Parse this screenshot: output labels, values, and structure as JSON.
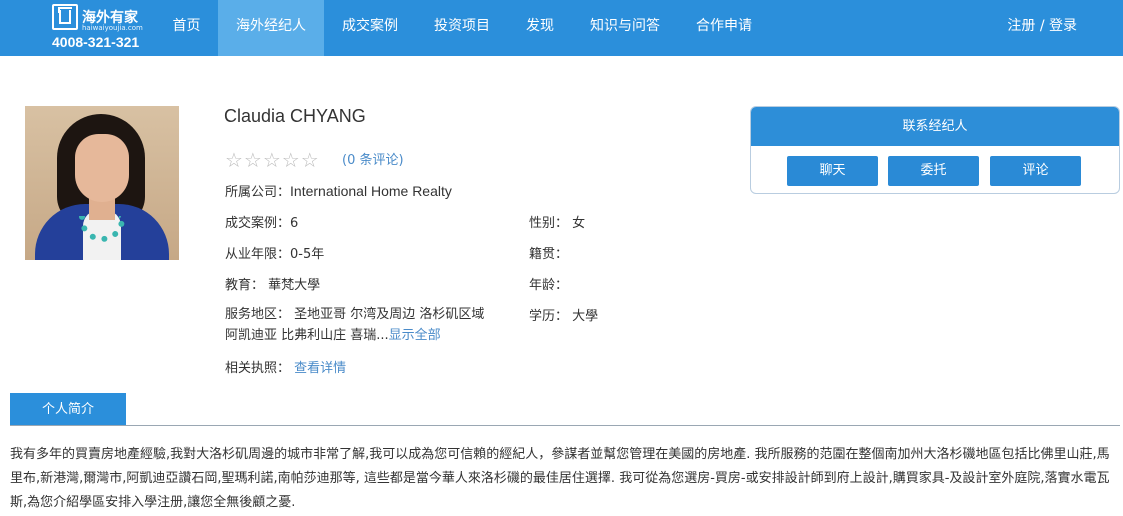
{
  "brand": {
    "name": "海外有家",
    "domain": "haiwaiyoujia.com",
    "phone": "4008-321-321",
    "colors": {
      "primary": "#2b8fdb",
      "active": "#5aaee9",
      "link": "#4a8bc9"
    }
  },
  "nav": {
    "items": [
      {
        "label": "首页"
      },
      {
        "label": "海外经纪人"
      },
      {
        "label": "成交案例"
      },
      {
        "label": "投资项目"
      },
      {
        "label": "发现"
      },
      {
        "label": "知识与问答"
      },
      {
        "label": "合作申请"
      }
    ],
    "active_index": 1,
    "login": "注册 / 登录"
  },
  "agent": {
    "name": "Claudia CHYANG",
    "rating_stars": "☆☆☆☆☆",
    "rating": 0,
    "reviews": "(0 条评论)",
    "company_label": "所属公司：",
    "company": "International Home Realty",
    "deals_label": "成交案例：",
    "deals": "6",
    "years_label": "从业年限：",
    "years": "0-5年",
    "education_label": "教育：",
    "education": "華梵大學",
    "service_label": "服务地区：",
    "service_text": "圣地亚哥 尔湾及周边 洛杉矶区域 阿凯迪亚 比弗利山庄 喜瑞...",
    "show_all": "显示全部",
    "license_label": "相关执照：",
    "license_link": "查看详情",
    "gender_label": "性别：",
    "gender": "女",
    "origin_label": "籍贯：",
    "origin": "",
    "age_label": "年龄：",
    "age": "",
    "degree_label": "学历：",
    "degree": "大學"
  },
  "contact": {
    "title": "联系经纪人",
    "buttons": [
      "聊天",
      "委托",
      "评论"
    ]
  },
  "intro": {
    "tab": "个人简介",
    "text": "我有多年的買賣房地產經驗,我對大洛杉矶周邊的城市非常了解,我可以成為您可信賴的經紀人，參謀者並幫您管理在美國的房地產. 我所服務的范圍在整個南加州大洛杉磯地區包括比佛里山莊,馬里布,新港灣,爾灣市,阿凱迪亞讚石岡,聖瑪利諾,南帕莎迪那等, 這些都是當今華人來洛杉磯的最佳居住選擇. 我可從為您選房-買房-或安排設計師到府上設計,購買家具-及設計室外庭院,落實水電瓦斯,為您介紹學區安排入學注册,讓您全無後顧之憂."
  }
}
